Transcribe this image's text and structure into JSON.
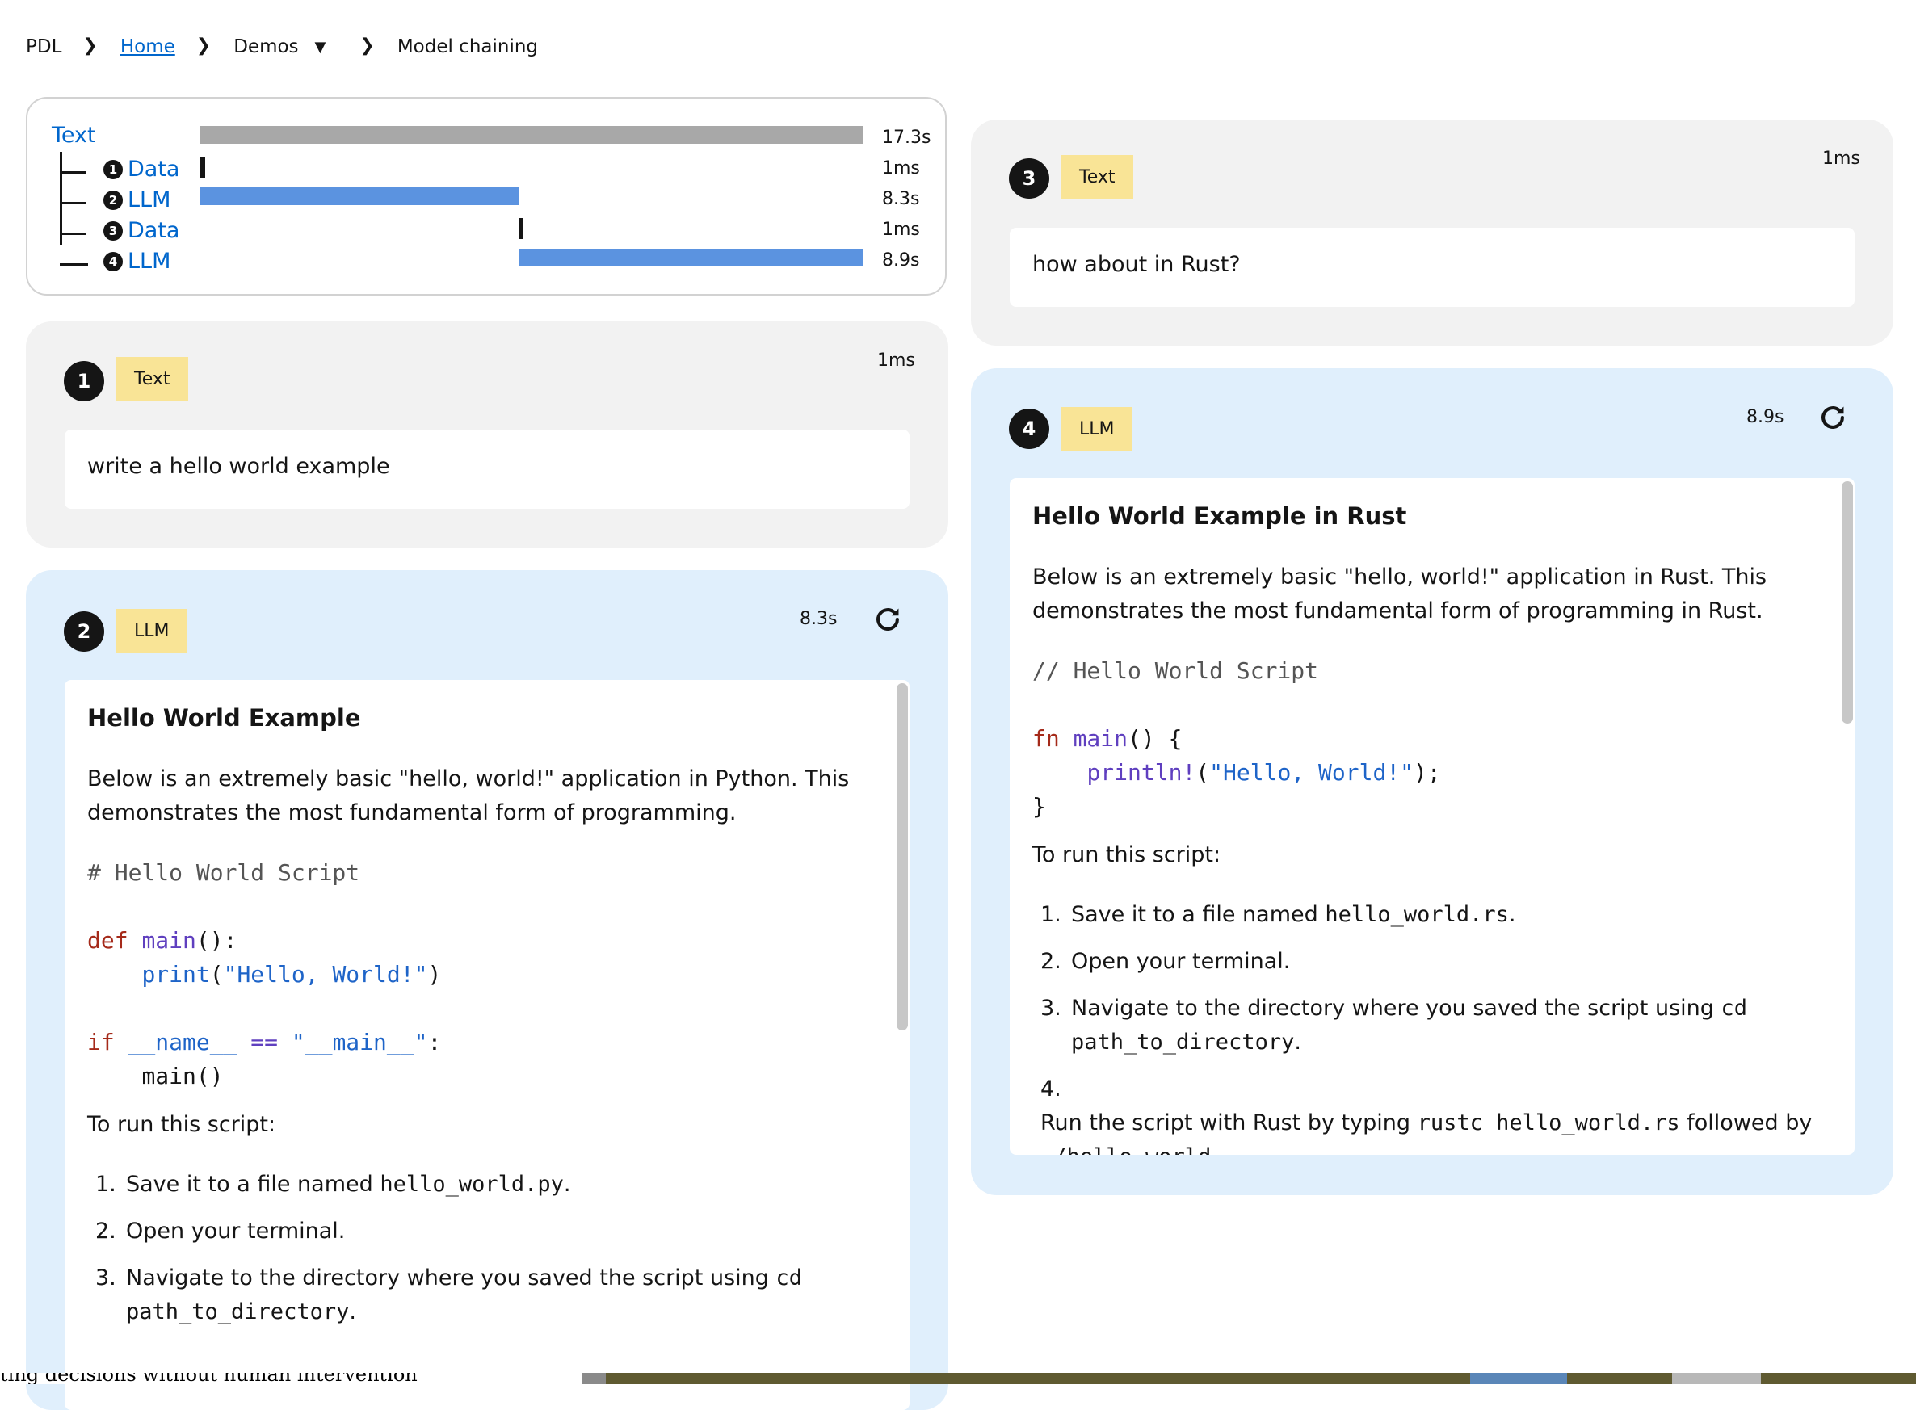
{
  "breadcrumb": {
    "root": "PDL",
    "home": "Home",
    "demos": "Demos",
    "current": "Model chaining",
    "separator_icon": "chevron-right-icon",
    "dropdown_icon": "caret-down-icon"
  },
  "timeline": {
    "root_label": "Text",
    "root_time": "17.3s",
    "rows": [
      {
        "num": "1",
        "label": "Data",
        "time": "1ms",
        "start": 0.0,
        "fraction": 0.0
      },
      {
        "num": "2",
        "label": "LLM",
        "time": "8.3s",
        "start": 0.0,
        "fraction": 0.48
      },
      {
        "num": "3",
        "label": "Data",
        "time": "1ms",
        "start": 0.48,
        "fraction": 0.0
      },
      {
        "num": "4",
        "label": "LLM",
        "time": "8.9s",
        "start": 0.48,
        "fraction": 0.52
      }
    ],
    "colors": {
      "root_bar": "#a8a8a8",
      "llm_bar": "#5b93e0",
      "data_bar": "#151515"
    }
  },
  "block1": {
    "step": "1",
    "kind": "Text",
    "duration": "1ms",
    "content": "write a hello world example"
  },
  "block2": {
    "step": "2",
    "kind": "LLM",
    "duration": "8.3s",
    "rerun_icon": "rerun-icon",
    "heading": "Hello World Example",
    "para1": "Below is an extremely basic \"hello, world!\" application in Python. This",
    "para2": "demonstrates the most fundamental form of programming.",
    "code": {
      "comment": "# Hello World Script",
      "def_kw": "def",
      "def_name": "main",
      "def_rest": "():",
      "print_fn": "print",
      "print_open": "(",
      "print_str": "\"Hello, World!\"",
      "print_close": ")",
      "if_kw": "if",
      "if_name": "__name__",
      "if_op": "==",
      "if_str": "\"__main__\"",
      "if_colon": ":",
      "call": "main()"
    },
    "run_intro": "To run this script:",
    "steps": [
      {
        "n": "1.",
        "pre": "Save it to a file named ",
        "code": "hello_world.py",
        "post": "."
      },
      {
        "n": "2.",
        "pre": "Open your terminal.",
        "code": "",
        "post": ""
      },
      {
        "n": "3.",
        "pre": "Navigate to the directory where you saved the script using ",
        "code": "cd",
        "post": ""
      }
    ],
    "step3_line2_code": "path_to_directory",
    "step3_line2_post": "."
  },
  "block3": {
    "step": "3",
    "kind": "Text",
    "duration": "1ms",
    "content": "how about in Rust?"
  },
  "block4": {
    "step": "4",
    "kind": "LLM",
    "duration": "8.9s",
    "rerun_icon": "rerun-icon",
    "heading": "Hello World Example in Rust",
    "para1": "Below is an extremely basic \"hello, world!\" application in Rust. This",
    "para2": "demonstrates the most fundamental form of programming in Rust.",
    "code": {
      "comment": "// Hello World Script",
      "fn_kw": "fn",
      "fn_name": "main",
      "fn_rest": "() {",
      "macro": "println!",
      "open": "(",
      "str": "\"Hello, World!\"",
      "close": ");",
      "brace": "}"
    },
    "run_intro": "To run this script:",
    "steps": [
      {
        "n": "1.",
        "pre": "Save it to a file named ",
        "code": "hello_world.rs",
        "post": "."
      },
      {
        "n": "2.",
        "pre": "Open your terminal.",
        "code": "",
        "post": ""
      },
      {
        "n": "3.",
        "pre": "Navigate to the directory where you saved the script using ",
        "code": "cd",
        "post": ""
      },
      {
        "n": "4.",
        "pre": "Run the script with Rust by typing ",
        "code": "rustc hello_world.rs",
        "post": " followed by"
      }
    ],
    "step3_line2_code": "path_to_directory",
    "step3_line2_post": ".",
    "step4_line2_code": "./hello_world",
    "step4_line2_post": "."
  },
  "background_text": "ting decisions without human intervention"
}
